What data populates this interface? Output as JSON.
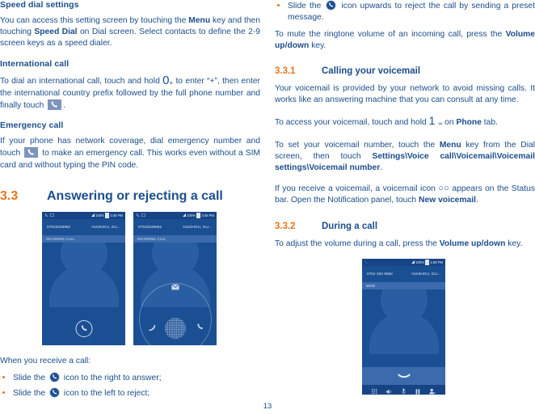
{
  "page": {
    "number": "13",
    "accent_orange": "#e8751a",
    "text_blue": "#1b4e8c",
    "phone_blue": "#1b4f93"
  },
  "left_column": {
    "speed_dial": {
      "heading": "Speed dial settings",
      "paragraph_1": "You can access this setting screen by touching the ",
      "bold_menu": "Menu",
      "paragraph_2": " key and then touching ",
      "bold_speed_dial": "Speed Dial",
      "paragraph_3": " on Dial screen. Select contacts to define the 2-9 screen keys as a speed dialer."
    },
    "international": {
      "heading": "International call",
      "text_1": "To dial an international call, touch and hold ",
      "key_icon": "0",
      "key_sub": "+",
      "text_2": " to enter “+”, then enter the international country prefix followed by the full phone number and finally touch ",
      "text_3": "."
    },
    "emergency": {
      "heading": "Emergency call",
      "text_1": "If your phone has network coverage, dial emergency number and touch ",
      "text_2": " to make an emergency call. This works even without a SIM card and without typing the PIN code."
    },
    "section": {
      "number": "3.3",
      "title": "Answering or rejecting a call"
    },
    "receive_intro": "When you receive a call:",
    "bullets": [
      {
        "pre": "Slide the ",
        "post": " icon to the right to answer;"
      },
      {
        "pre": "Slide the ",
        "post": " icon to the left to reject;"
      }
    ]
  },
  "right_column": {
    "bullet_reject": {
      "pre": "Slide the ",
      "post": " icon upwards to reject the call by sending a preset message."
    },
    "mute_text_1": "To mute the ringtone volume of an incoming call, press the ",
    "mute_bold": "Volume up/down",
    "mute_text_2": " key.",
    "voicemail_section": {
      "number": "3.3.1",
      "title": "Calling your voicemail"
    },
    "vm_para_1": "Your voicemail is provided by your network to avoid missing calls. It works like an answering machine that you can consult at any time.",
    "vm_access_1": "To access your voicemail, touch and hold ",
    "vm_access_key": "1",
    "vm_access_sub": "∞",
    "vm_access_2": " on ",
    "vm_access_bold": "Phone",
    "vm_access_3": " tab.",
    "vm_set_1": "To set your voicemail number, touch the ",
    "vm_set_bold_menu": "Menu",
    "vm_set_2": " key from the Dial screen, then touch ",
    "vm_set_bold_path": "Settings\\Voice call\\Voicemail\\Voicemail settings\\Voicemail number",
    "vm_set_3": ".",
    "vm_receive_1": "If you receive a voicemail, a voicemail icon ",
    "vm_receive_icon": "○○",
    "vm_receive_2": " appears on the Status bar. Open the Notification panel, touch ",
    "vm_receive_bold": "New voicemail",
    "vm_receive_3": ".",
    "during_call_section": {
      "number": "3.3.2",
      "title": "During a call"
    },
    "during_call_1": "To adjust the volume during a call, press the ",
    "during_call_bold": "Volume up/down",
    "during_call_2": " key."
  },
  "phone_screens": {
    "incoming_1": {
      "status_battery": "100%",
      "status_time": "3:48 PM",
      "number": "07522639962",
      "location": "HUIZHOU, GU...",
      "banner": "INCOMING CALL"
    },
    "incoming_2": {
      "status_battery": "100%",
      "status_time": "3:48 PM",
      "number": "07522639962",
      "location": "HUIZHOU, GU...",
      "banner": "INCOMING CALL"
    },
    "in_call": {
      "status_battery": "100%",
      "status_time": "1:59 PM",
      "number": "0752 263 9962",
      "location": "HUIZHOU, GU...",
      "timer": "00:02",
      "toolbar_icons": [
        "dialpad-icon",
        "speaker-icon",
        "mute-icon",
        "hold-icon",
        "add-call-icon"
      ]
    }
  }
}
